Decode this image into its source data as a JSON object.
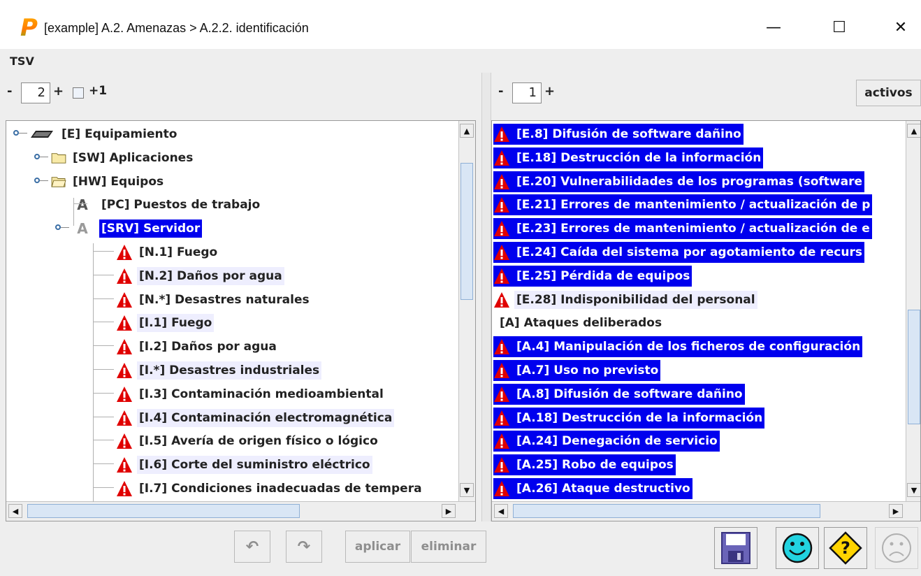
{
  "window": {
    "title": "[example] A.2. Amenazas > A.2.2. identificación",
    "minimize_glyph": "—",
    "maximize_glyph": "☐",
    "close_glyph": "✕"
  },
  "menu": {
    "tsv": "TSV"
  },
  "left_panel": {
    "minus": "-",
    "level": "2",
    "plus": "+",
    "plus_one": "+1",
    "plus_one_checked": false,
    "tree": [
      {
        "label": "[E] Equipamiento",
        "icon": "equipment-icon",
        "indent": 0,
        "selected": false
      },
      {
        "label": "[SW] Aplicaciones",
        "icon": "folder-icon",
        "indent": 1,
        "selected": false
      },
      {
        "label": "[HW] Equipos",
        "icon": "folder-open-icon",
        "indent": 1,
        "selected": false
      },
      {
        "label": "[PC] Puestos de trabajo",
        "icon": "asset-a-icon",
        "indent": 2,
        "selected": false
      },
      {
        "label": "[SRV] Servidor",
        "icon": "asset-a-icon",
        "indent": 2,
        "selected": true
      },
      {
        "label": "[N.1] Fuego",
        "icon": "warning-icon",
        "indent": 3,
        "selected": false
      },
      {
        "label": "[N.2] Daños por agua",
        "icon": "warning-icon",
        "indent": 3,
        "selected": false
      },
      {
        "label": "[N.*] Desastres naturales",
        "icon": "warning-icon",
        "indent": 3,
        "selected": false
      },
      {
        "label": "[I.1] Fuego",
        "icon": "warning-icon",
        "indent": 3,
        "selected": false
      },
      {
        "label": "[I.2] Daños por agua",
        "icon": "warning-icon",
        "indent": 3,
        "selected": false
      },
      {
        "label": "[I.*] Desastres industriales",
        "icon": "warning-icon",
        "indent": 3,
        "selected": false
      },
      {
        "label": "[I.3] Contaminación medioambiental",
        "icon": "warning-icon",
        "indent": 3,
        "selected": false
      },
      {
        "label": "[I.4] Contaminación electromagnética",
        "icon": "warning-icon",
        "indent": 3,
        "selected": false
      },
      {
        "label": "[I.5] Avería de origen físico o lógico",
        "icon": "warning-icon",
        "indent": 3,
        "selected": false
      },
      {
        "label": "[I.6] Corte del suministro eléctrico",
        "icon": "warning-icon",
        "indent": 3,
        "selected": false
      },
      {
        "label": "[I.7] Condiciones inadecuadas de tempera",
        "icon": "warning-icon",
        "indent": 3,
        "selected": false
      }
    ]
  },
  "right_panel": {
    "minus": "-",
    "level": "1",
    "plus": "+",
    "activos_label": "activos",
    "list": [
      {
        "label": "[E.8] Difusión de software dañino",
        "icon": "warning-icon",
        "selected": true
      },
      {
        "label": "[E.18] Destrucción de la información",
        "icon": "warning-icon",
        "selected": true
      },
      {
        "label": "[E.20] Vulnerabilidades de los programas (software",
        "icon": "warning-icon",
        "selected": true
      },
      {
        "label": "[E.21] Errores de mantenimiento / actualización de p",
        "icon": "warning-icon",
        "selected": true
      },
      {
        "label": "[E.23] Errores de mantenimiento / actualización de e",
        "icon": "warning-icon",
        "selected": true
      },
      {
        "label": "[E.24] Caída del sistema por agotamiento de recurs",
        "icon": "warning-icon",
        "selected": true
      },
      {
        "label": "[E.25] Pérdida de equipos",
        "icon": "warning-icon",
        "selected": true
      },
      {
        "label": "[E.28] Indisponibilidad del personal",
        "icon": "warning-icon",
        "selected": false
      },
      {
        "label": "[A] Ataques deliberados",
        "icon": "",
        "selected": false
      },
      {
        "label": "[A.4] Manipulación de los ficheros de configuración",
        "icon": "warning-icon",
        "selected": true
      },
      {
        "label": "[A.7] Uso no previsto",
        "icon": "warning-icon",
        "selected": true
      },
      {
        "label": "[A.8] Difusión de software dañino",
        "icon": "warning-icon",
        "selected": true
      },
      {
        "label": "[A.18] Destrucción de la información",
        "icon": "warning-icon",
        "selected": true
      },
      {
        "label": "[A.24] Denegación de servicio",
        "icon": "warning-icon",
        "selected": true
      },
      {
        "label": "[A.25] Robo de equipos",
        "icon": "warning-icon",
        "selected": true
      },
      {
        "label": "[A.26] Ataque destructivo",
        "icon": "warning-icon",
        "selected": true
      }
    ]
  },
  "bottom": {
    "undo_glyph": "↶",
    "redo_glyph": "↷",
    "aplicar": "aplicar",
    "eliminar": "eliminar"
  },
  "colors": {
    "selection": "#0000ee",
    "warning_red": "#e00000"
  }
}
